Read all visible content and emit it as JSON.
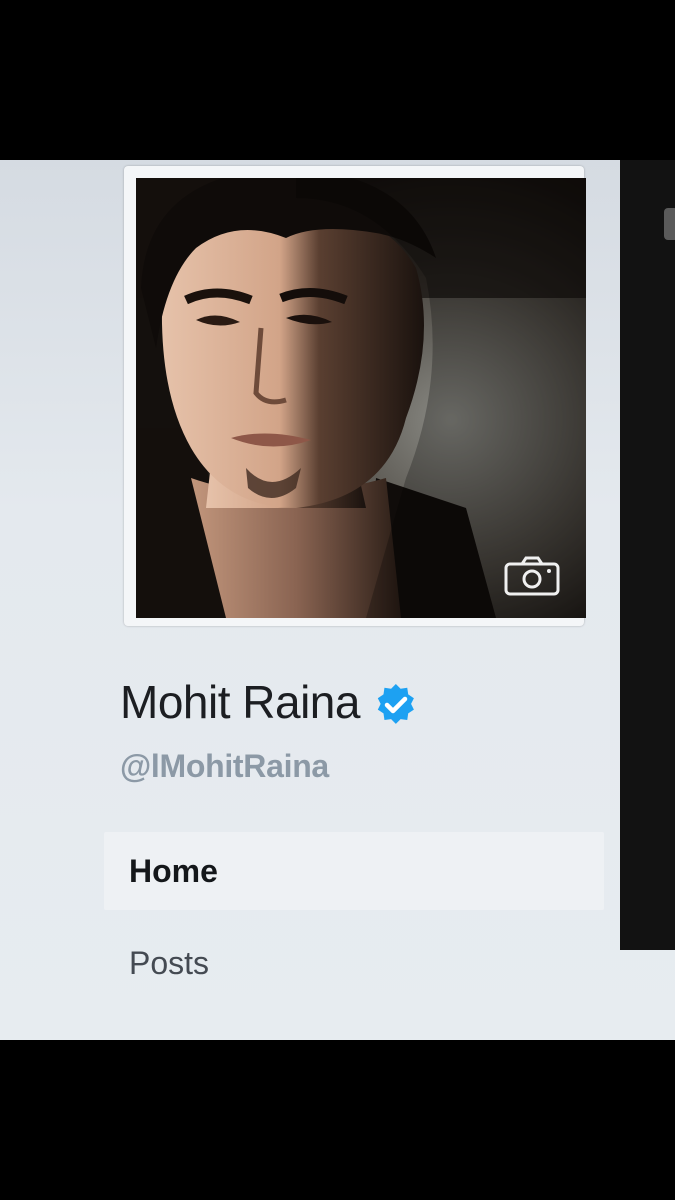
{
  "profile": {
    "display_name": "Mohit Raina",
    "handle": "@lMohitRaina",
    "verified": true,
    "verified_icon": "verified-badge-icon",
    "photo_action_icon": "camera-icon"
  },
  "nav": {
    "items": [
      {
        "label": "Home",
        "active": true
      },
      {
        "label": "Posts",
        "active": false
      }
    ]
  },
  "colors": {
    "verified_blue": "#1da1f2",
    "name_text": "#1c1e22",
    "handle_text": "#8c99a6",
    "active_nav_bg": "#eef1f4"
  }
}
